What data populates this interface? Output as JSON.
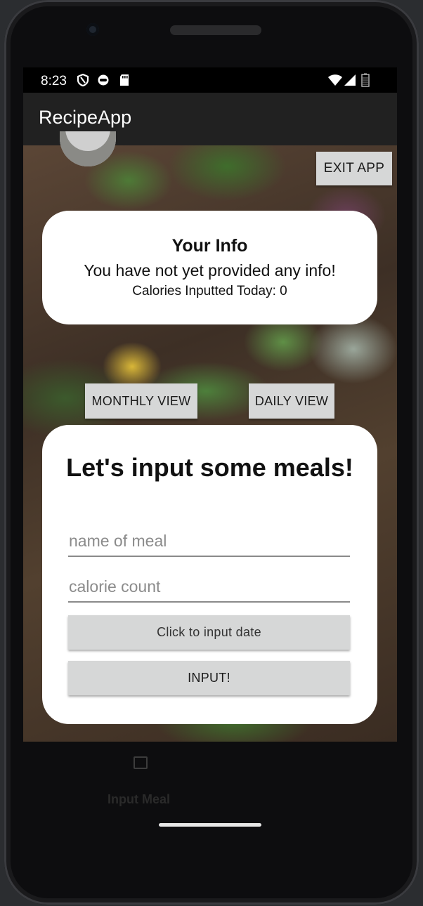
{
  "status_bar": {
    "time": "8:23",
    "left_icons": [
      "shield-icon",
      "face-icon",
      "sd-card-icon"
    ],
    "right_icons": [
      "wifi-icon",
      "signal-icon",
      "battery-icon"
    ]
  },
  "app_bar": {
    "title": "RecipeApp"
  },
  "buttons": {
    "exit": "EXIT APP",
    "monthly": "MONTHLY VIEW",
    "daily": "DAILY VIEW",
    "input_date": "Click to input date",
    "input": "INPUT!"
  },
  "info_card": {
    "title": "Your Info",
    "message": "You have not yet provided any info!",
    "calories": "Calories Inputted Today: 0"
  },
  "meal_card": {
    "heading": "Let's input some meals!",
    "meal_name_placeholder": "name of meal",
    "calorie_placeholder": "calorie count"
  },
  "bottom_nav": {
    "label": "Input Meal",
    "icon": "input-icon"
  },
  "colors": {
    "app_bar": "#212121",
    "button": "#d6d7d7",
    "card": "#ffffff"
  }
}
